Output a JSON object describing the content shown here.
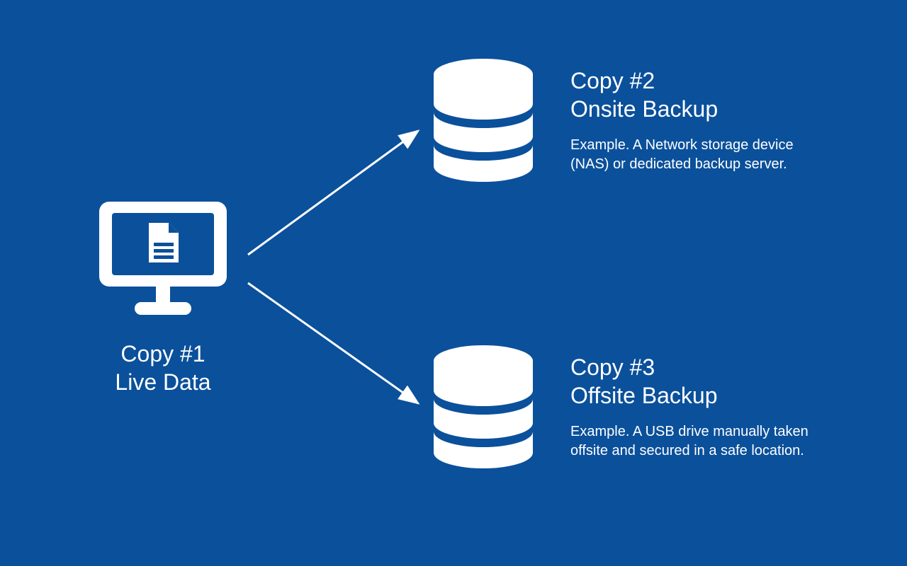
{
  "colors": {
    "bg": "#0b509b",
    "fg": "#ffffff"
  },
  "source": {
    "title_line1": "Copy #1",
    "title_line2": "Live Data",
    "icon": "monitor-document-icon"
  },
  "destinations": [
    {
      "id": "onsite",
      "title_line1": "Copy #2",
      "title_line2": "Onsite Backup",
      "description": "Example. A Network storage device (NAS) or dedicated backup server.",
      "icon": "database-icon"
    },
    {
      "id": "offsite",
      "title_line1": "Copy #3",
      "title_line2": "Offsite Backup",
      "description": "Example. A USB drive manually taken offsite and secured in a safe location.",
      "icon": "database-icon"
    }
  ]
}
